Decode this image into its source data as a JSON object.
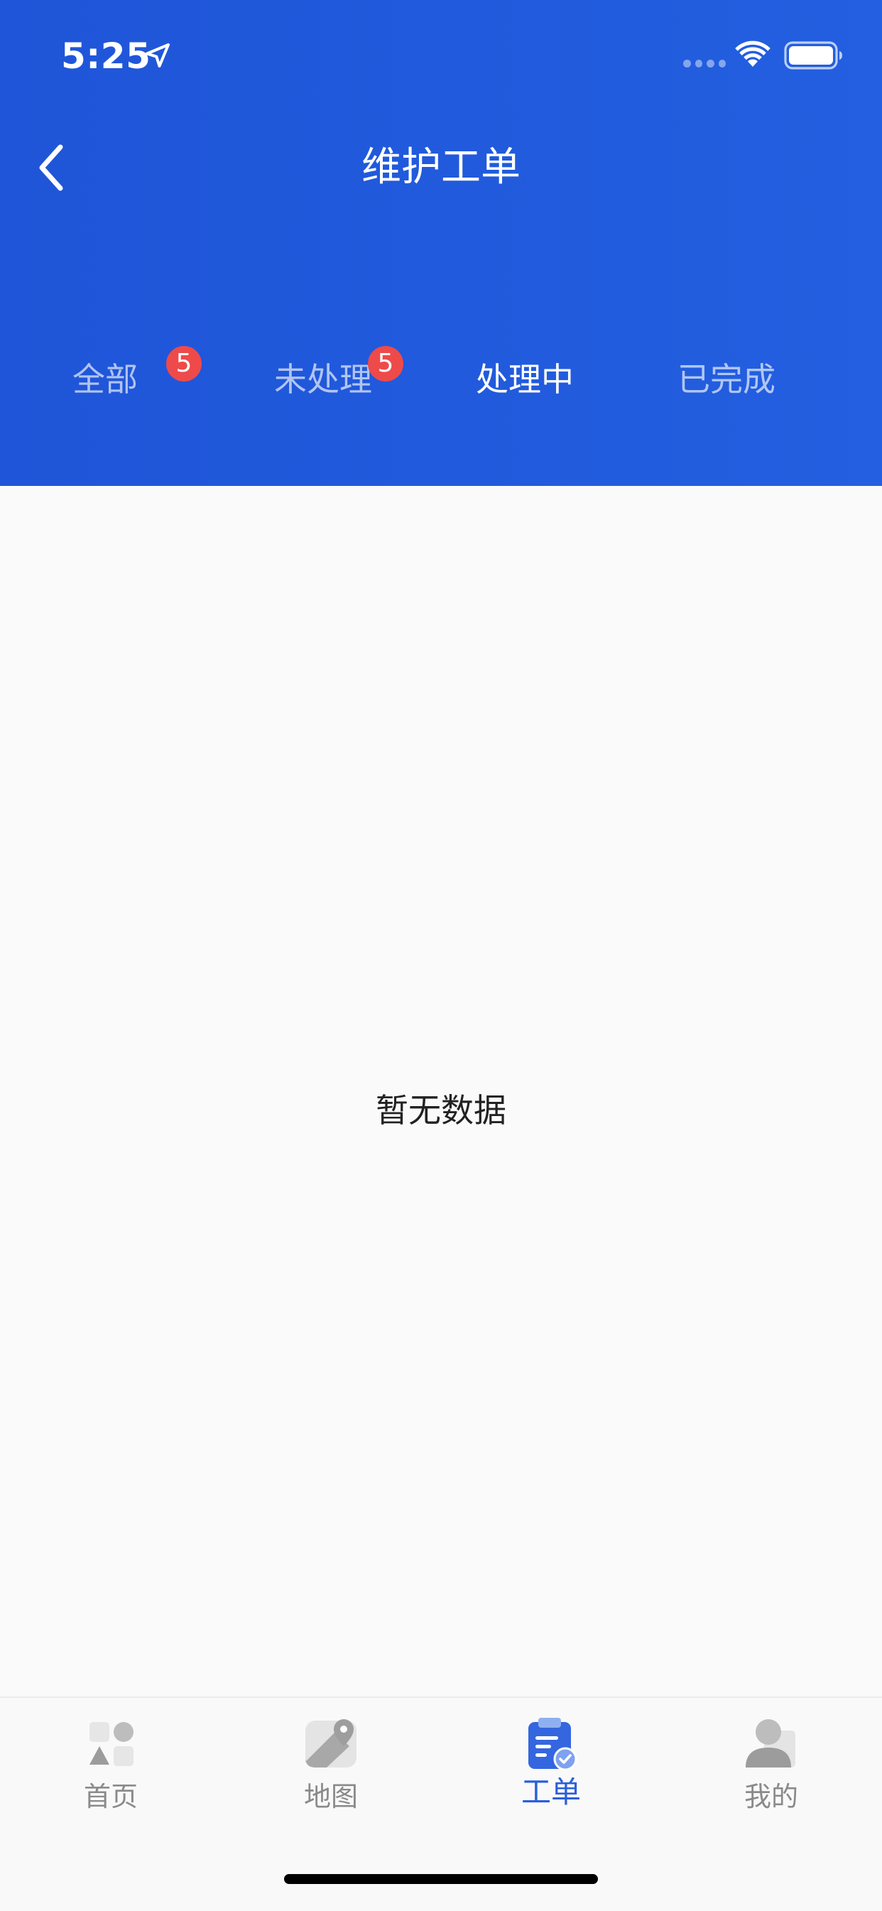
{
  "status_bar": {
    "time": "5:25"
  },
  "header": {
    "title": "维护工单",
    "back_icon": "chevron-left-icon"
  },
  "tabs": [
    {
      "label": "全部",
      "badge": "5",
      "active": false
    },
    {
      "label": "未处理",
      "badge": "5",
      "active": false
    },
    {
      "label": "处理中",
      "badge": null,
      "active": true
    },
    {
      "label": "已完成",
      "badge": null,
      "active": false
    }
  ],
  "main": {
    "empty_text": "暂无数据"
  },
  "tab_bar": {
    "items": [
      {
        "label": "首页",
        "icon": "home-icon",
        "active": false
      },
      {
        "label": "地图",
        "icon": "map-icon",
        "active": false
      },
      {
        "label": "工单",
        "icon": "work-order-icon",
        "active": true
      },
      {
        "label": "我的",
        "icon": "user-icon",
        "active": false
      }
    ]
  },
  "colors": {
    "header_blue": "#1f55d8",
    "accent_blue": "#2a5fdb",
    "badge_red": "#ee4a4a",
    "inactive_gray": "#8a8a8a"
  }
}
